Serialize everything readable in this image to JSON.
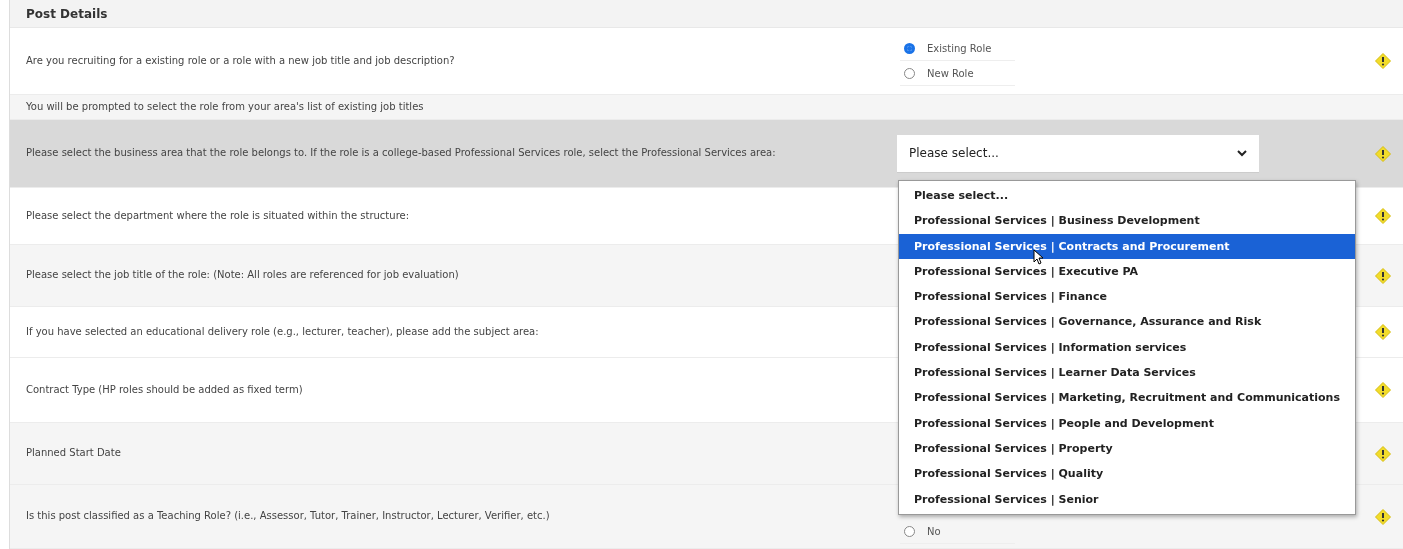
{
  "section_title": "Post Details",
  "questions": [
    {
      "label": "Are you recruiting for a existing role or a role with a new job title and job description?",
      "highlighted": false,
      "has_help": true,
      "control": {
        "kind": "radio",
        "options": [
          {
            "label": "Existing Role",
            "selected": true
          },
          {
            "label": "New Role",
            "selected": false
          }
        ]
      }
    },
    {
      "label": "You will be prompted to select the role from your area's list of existing job titles",
      "highlighted": false,
      "has_help": false,
      "control": {
        "kind": "none"
      }
    },
    {
      "label": "Please select the business area that the role belongs to. If the role is a college-based Professional Services role, select the Professional Services area:",
      "highlighted": true,
      "has_help": true,
      "control": {
        "kind": "select",
        "value": "Please select...",
        "expanded": true
      }
    },
    {
      "label": "Please select the department where the role is situated within the structure:",
      "highlighted": false,
      "has_help": true,
      "control": {
        "kind": "none"
      }
    },
    {
      "label": "Please select the job title of the role: (Note: All roles are referenced for job evaluation)",
      "highlighted": false,
      "has_help": true,
      "control": {
        "kind": "none"
      }
    },
    {
      "label": "If you have selected an educational delivery role (e.g., lecturer, teacher), please add the subject area:",
      "highlighted": false,
      "has_help": true,
      "control": {
        "kind": "none"
      }
    },
    {
      "label": "Contract Type (HP roles should be added as fixed term)",
      "highlighted": false,
      "has_help": true,
      "control": {
        "kind": "none"
      }
    },
    {
      "label": "Planned Start Date",
      "highlighted": false,
      "has_help": true,
      "control": {
        "kind": "none"
      }
    },
    {
      "label": "Is this post classified as a Teaching Role? (i.e., Assessor, Tutor, Trainer, Instructor, Lecturer, Verifier, etc.)",
      "highlighted": false,
      "has_help": true,
      "control": {
        "kind": "radio",
        "options": [
          {
            "label": "No",
            "selected": false
          }
        ]
      }
    }
  ],
  "dropdown": {
    "options": [
      {
        "label": "Please select...",
        "selected": false
      },
      {
        "label": "Professional Services | Business Development",
        "selected": false
      },
      {
        "label": "Professional Services | Contracts and Procurement",
        "selected": true
      },
      {
        "label": "Professional Services | Executive PA",
        "selected": false
      },
      {
        "label": "Professional Services | Finance",
        "selected": false
      },
      {
        "label": "Professional Services | Governance, Assurance and Risk",
        "selected": false
      },
      {
        "label": "Professional Services | Information services",
        "selected": false
      },
      {
        "label": "Professional Services | Learner Data Services",
        "selected": false
      },
      {
        "label": "Professional Services | Marketing, Recruitment and Communications",
        "selected": false
      },
      {
        "label": "Professional Services | People and Development",
        "selected": false
      },
      {
        "label": "Professional Services | Property",
        "selected": false
      },
      {
        "label": "Professional Services | Quality",
        "selected": false
      },
      {
        "label": "Professional Services | Senior",
        "selected": false
      }
    ]
  }
}
